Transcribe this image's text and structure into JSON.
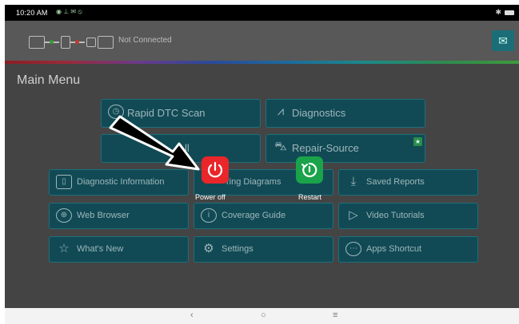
{
  "status_bar": {
    "time": "10:20 AM",
    "icons": "◉ ⊥ ✉ ⦸",
    "right_icons": "✱"
  },
  "header": {
    "connection_status": "Not Connected"
  },
  "main": {
    "title": "Main Menu",
    "primary_tiles": [
      {
        "label": "Rapid DTC Scan",
        "icon": "clock-icon"
      },
      {
        "label": "Diagnostics",
        "icon": "pulse-icon"
      },
      {
        "label": "ll",
        "icon": ""
      },
      {
        "label": "Repair-Source",
        "icon": "car-repair-icon"
      }
    ],
    "tiles": [
      {
        "label": "Diagnostic Information",
        "icon": "info-panel-icon"
      },
      {
        "label": "ring Diagrams",
        "icon": ""
      },
      {
        "label": "Saved Reports",
        "icon": "download-icon"
      },
      {
        "label": "Web Browser",
        "icon": "globe-icon"
      },
      {
        "label": "Coverage Guide",
        "icon": "info-icon"
      },
      {
        "label": "Video Tutorials",
        "icon": "play-icon"
      },
      {
        "label": "What's New",
        "icon": "star-icon"
      },
      {
        "label": "Settings",
        "icon": "gear-icon"
      },
      {
        "label": "Apps Shortcut",
        "icon": "apps-icon"
      }
    ]
  },
  "power_menu": {
    "power_off_label": "Power off",
    "restart_label": "Restart",
    "power_off_color": "#e9262a",
    "restart_color": "#1aa34a"
  },
  "nav_bar": {
    "back": "‹",
    "home": "○",
    "recents": "≡"
  }
}
